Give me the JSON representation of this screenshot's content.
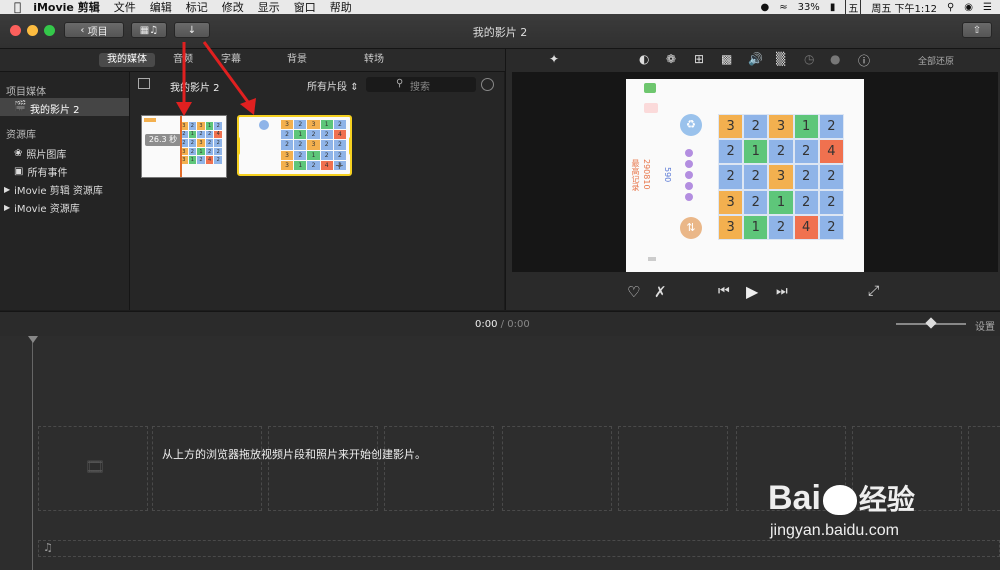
{
  "menubar": {
    "app": "iMovie 剪辑",
    "items": [
      "文件",
      "编辑",
      "标记",
      "修改",
      "显示",
      "窗口",
      "帮助"
    ],
    "battery": "33%",
    "ime": "五",
    "datetime": "周五 下午1:12"
  },
  "toolbar": {
    "back_label": "项目",
    "window_title": "我的影片 2"
  },
  "tabs": [
    "我的媒体",
    "音频",
    "字幕",
    "背景",
    "转场"
  ],
  "sidebar": {
    "section1": "项目媒体",
    "project": "我的影片 2",
    "section2": "资源库",
    "items": [
      "照片图库",
      "所有事件",
      "iMovie 剪辑 资源库",
      "iMovie 资源库"
    ]
  },
  "browser": {
    "title": "我的影片 2",
    "filter": "所有片段",
    "search_placeholder": "搜索",
    "clip1_duration": "26.3 秒"
  },
  "viewer": {
    "restore_label": "全部还原",
    "game": {
      "best_label": "最高记录",
      "best_score": "290810",
      "score": "590"
    }
  },
  "timeline": {
    "time_current": "0:00",
    "time_sep": "/",
    "time_total": "0:00",
    "settings_label": "设置",
    "hint": "从上方的浏览器拖放视频片段和照片来开始创建影片。"
  },
  "grid": {
    "rows": [
      [
        "3",
        "2",
        "3",
        "1",
        "2"
      ],
      [
        "2",
        "1",
        "2",
        "2",
        "4"
      ],
      [
        "2",
        "2",
        "3",
        "2",
        "2"
      ],
      [
        "3",
        "2",
        "1",
        "2",
        "2"
      ],
      [
        "3",
        "1",
        "2",
        "4",
        "2"
      ]
    ],
    "colors": [
      [
        "#f3b04f",
        "#8fb4e8",
        "#f3b04f",
        "#5ec67a",
        "#8fb4e8"
      ],
      [
        "#8fb4e8",
        "#5ec67a",
        "#8fb4e8",
        "#8fb4e8",
        "#f0714f"
      ],
      [
        "#8fb4e8",
        "#8fb4e8",
        "#f3b04f",
        "#8fb4e8",
        "#8fb4e8"
      ],
      [
        "#f3b04f",
        "#8fb4e8",
        "#5ec67a",
        "#8fb4e8",
        "#8fb4e8"
      ],
      [
        "#f3b04f",
        "#5ec67a",
        "#8fb4e8",
        "#f0714f",
        "#8fb4e8"
      ]
    ]
  },
  "watermark": {
    "brand": "Bai",
    "brand2": "经验",
    "url": "jingyan.baidu.com"
  },
  "colors": {
    "arrow": "#e02020",
    "selection": "#f5d020",
    "accent": "#0a84ff"
  }
}
